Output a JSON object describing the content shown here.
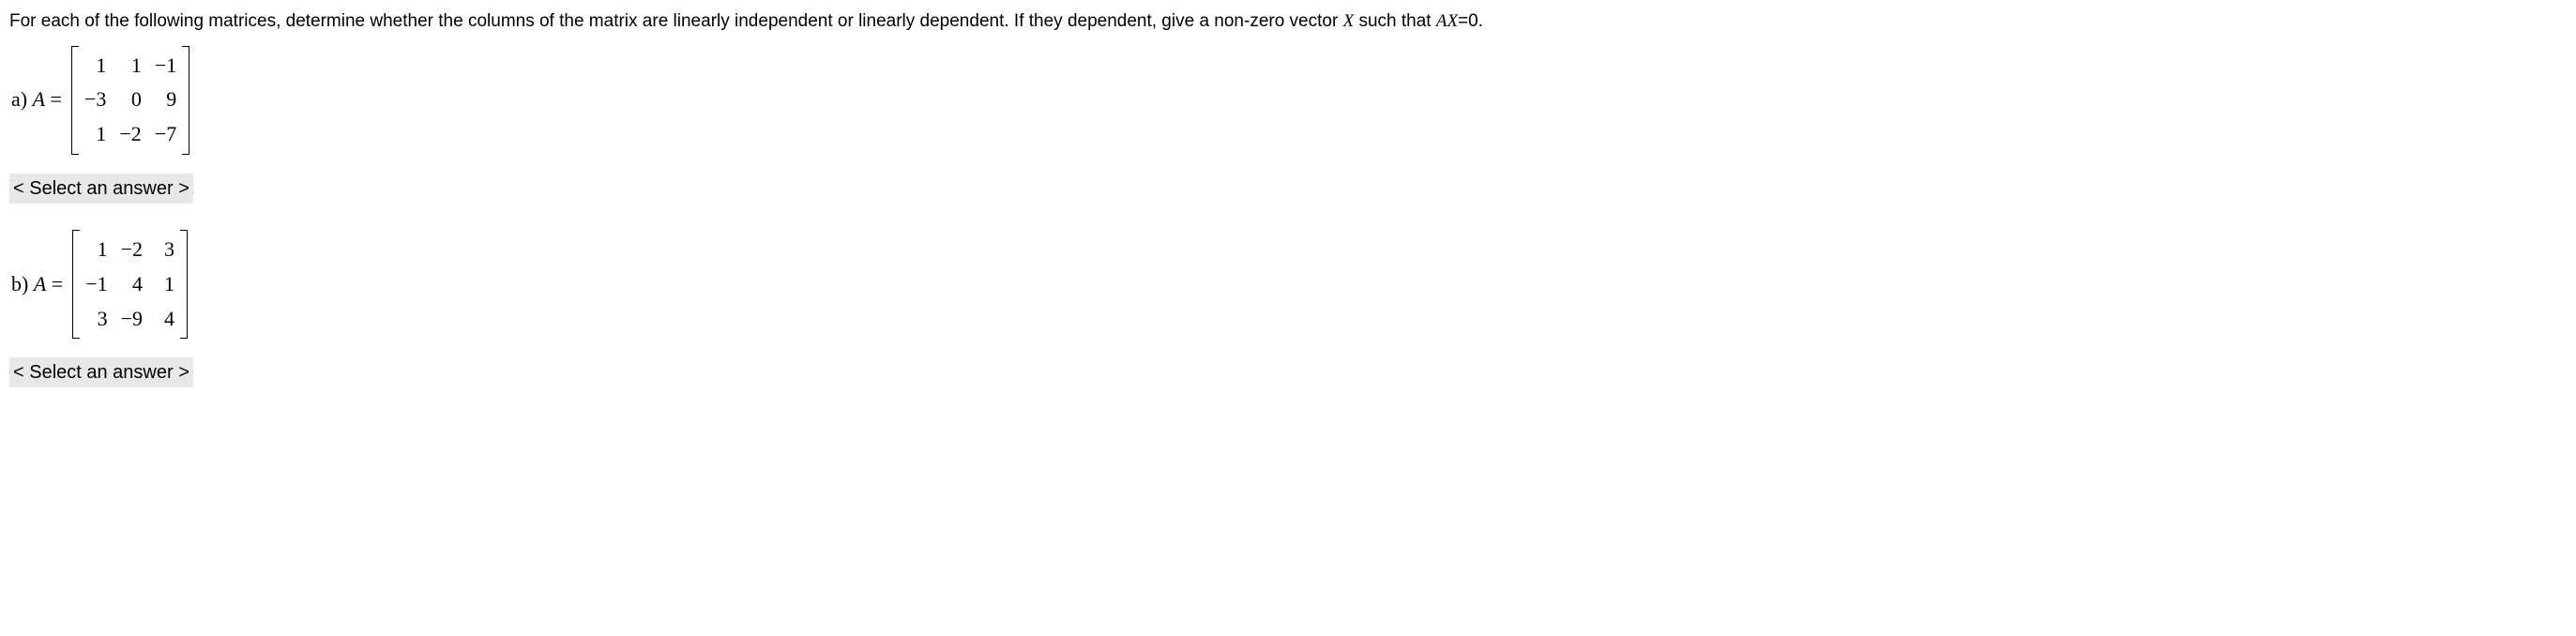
{
  "instructions_pre": "For each of the following matrices, determine whether the columns of the matrix are linearly independent or linearly dependent. If they dependent, give a non-zero vector ",
  "instructions_var": "X",
  "instructions_mid": " such that ",
  "instructions_eq": "AX",
  "instructions_post": "=0.",
  "problems": {
    "a": {
      "label": "a) ",
      "var": "A",
      "eq": " = ",
      "matrix": [
        "1",
        "1",
        "−1",
        "−3",
        "0",
        "9",
        "1",
        "−2",
        "−7"
      ]
    },
    "b": {
      "label": "b) ",
      "var": "A",
      "eq": " = ",
      "matrix": [
        "1",
        "−2",
        "3",
        "−1",
        "4",
        "1",
        "3",
        "−9",
        "4"
      ]
    }
  },
  "select_placeholder": "< Select an answer >"
}
